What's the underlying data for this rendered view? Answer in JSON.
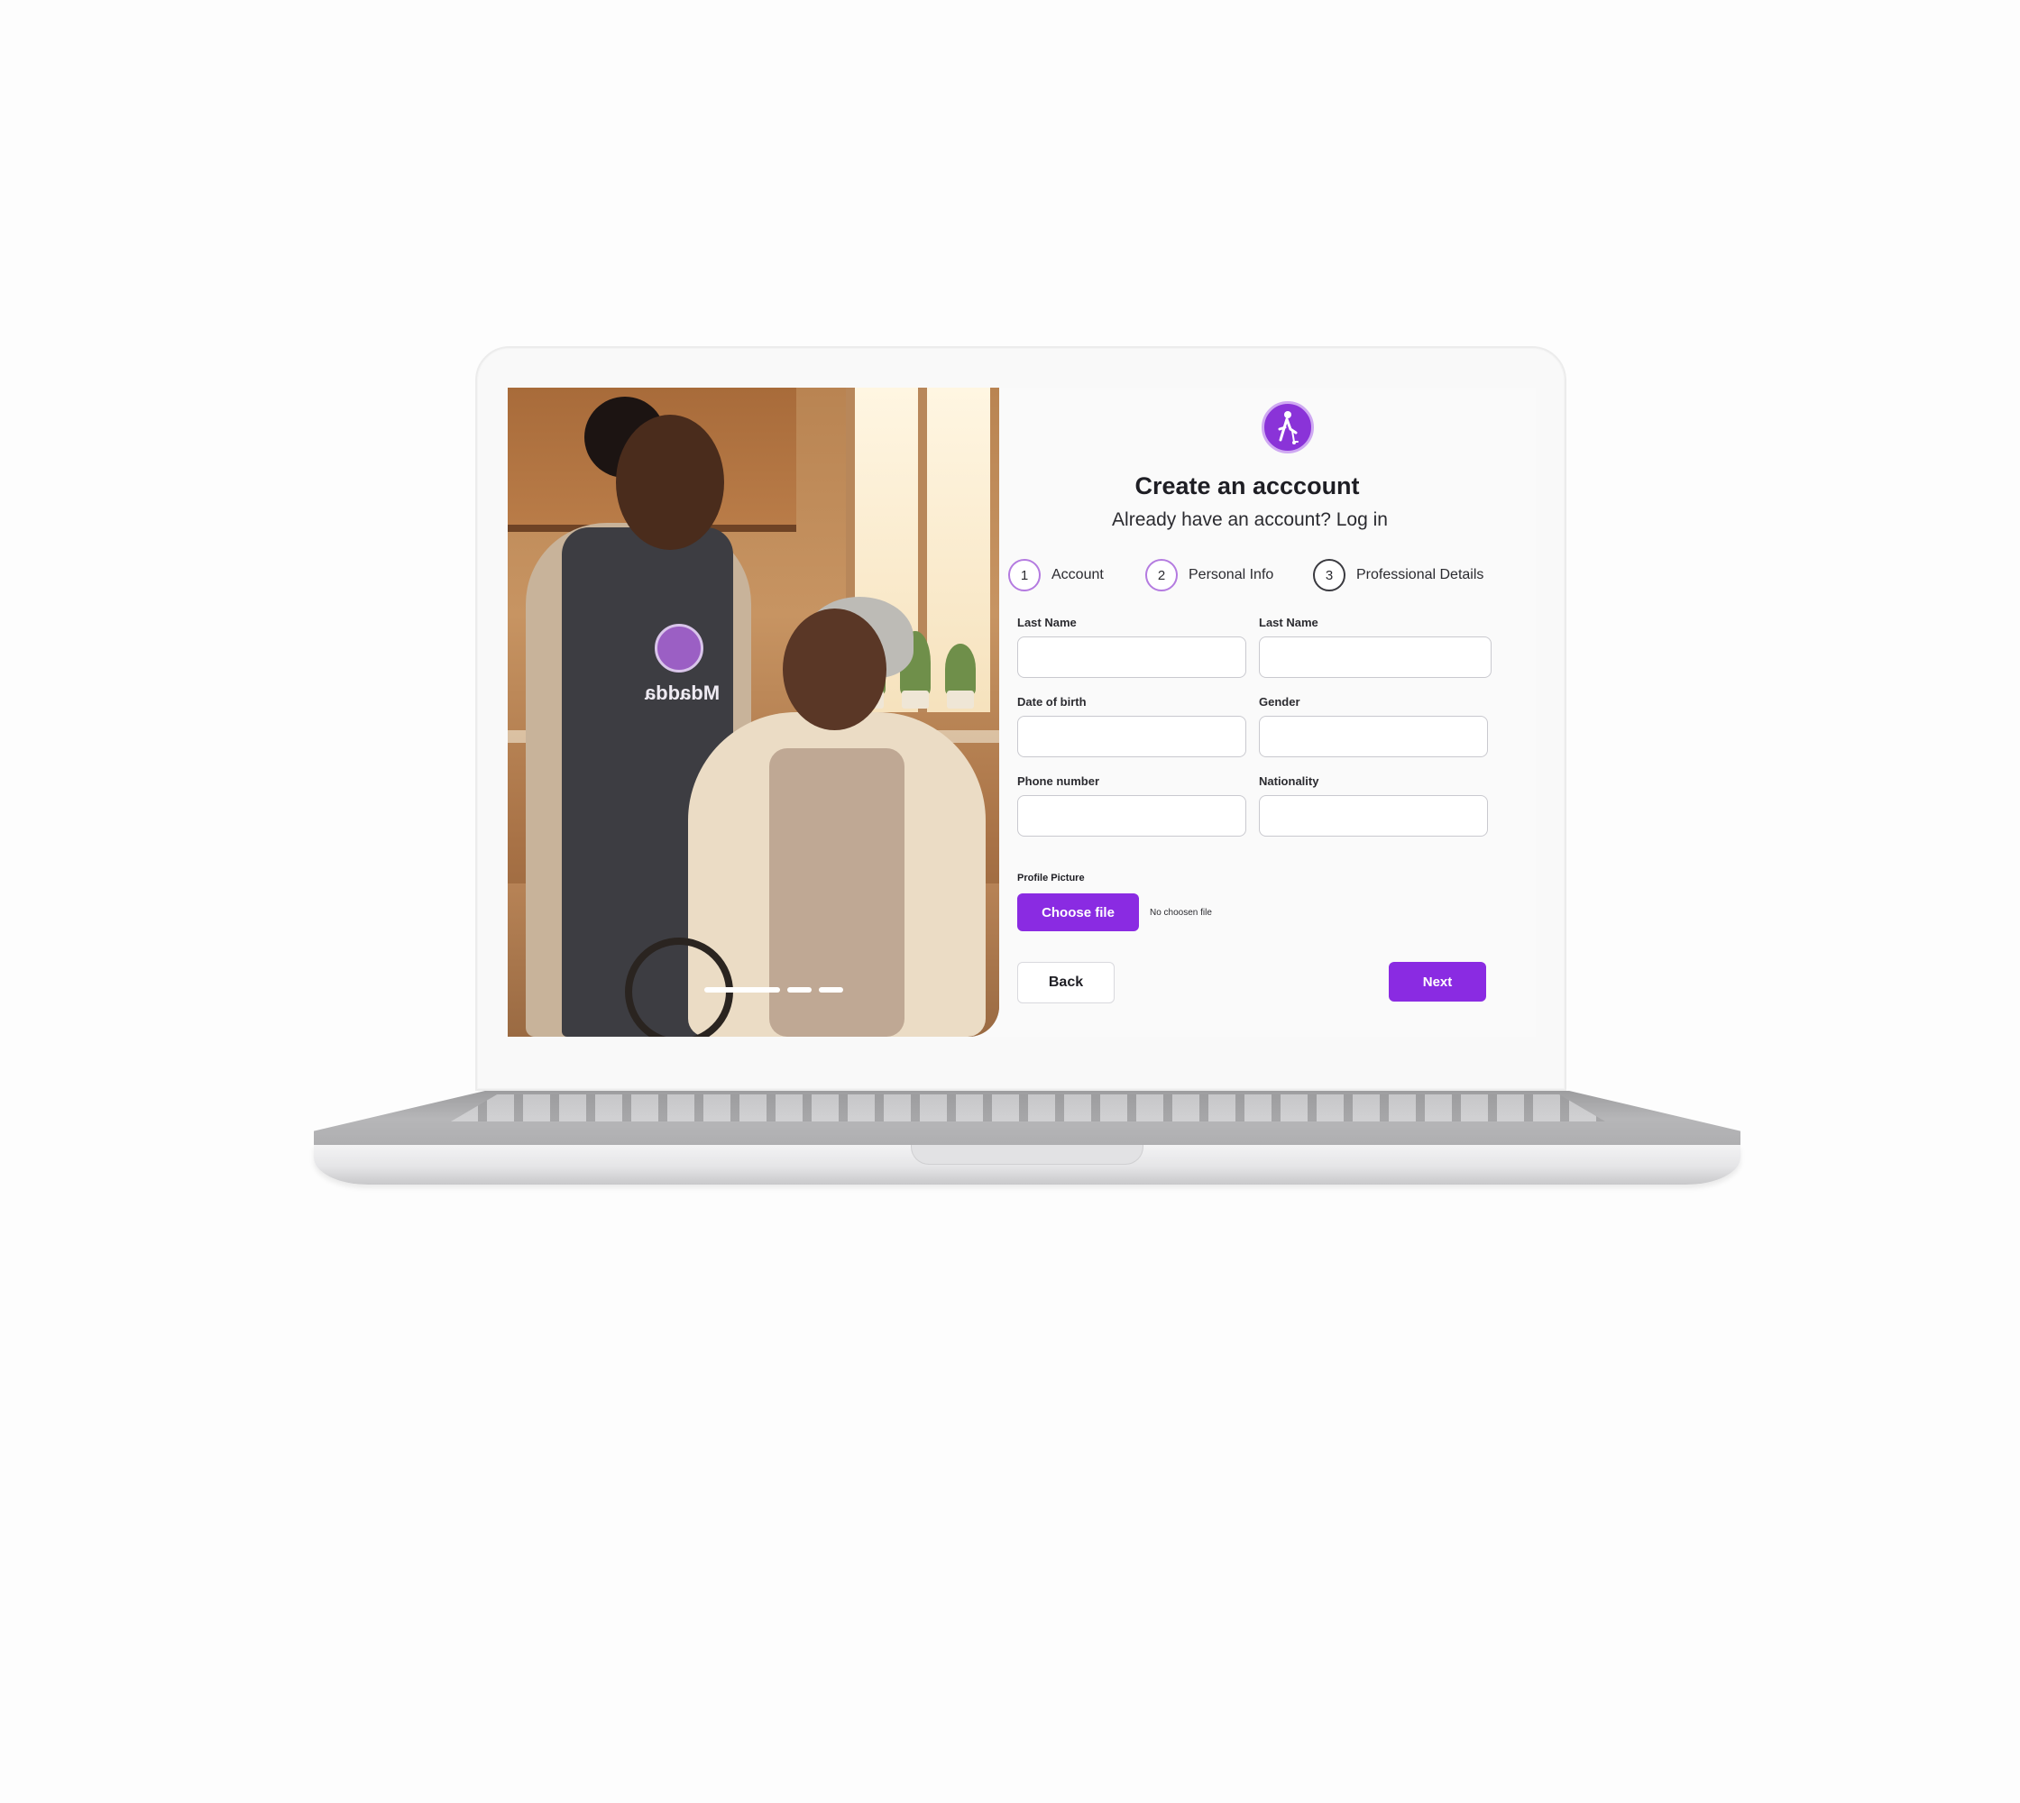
{
  "brand": {
    "logo_icon": "walker-person-icon",
    "accent_color": "#8a2be2",
    "apron_logo_text": "Mdadda"
  },
  "header": {
    "title": "Create an acccount",
    "subtitle": "Already have an account? Log in"
  },
  "steps": [
    {
      "number": "1",
      "label": "Account"
    },
    {
      "number": "2",
      "label": "Personal Info"
    },
    {
      "number": "3",
      "label": "Professional Details"
    }
  ],
  "fields": {
    "first_name": {
      "label": "Last Name",
      "value": ""
    },
    "last_name": {
      "label": "Last Name",
      "value": ""
    },
    "dob": {
      "label": "Date of birth",
      "value": ""
    },
    "gender": {
      "label": "Gender",
      "value": ""
    },
    "phone": {
      "label": "Phone number",
      "value": ""
    },
    "nationality": {
      "label": "Nationality",
      "value": ""
    }
  },
  "upload": {
    "label": "Profile Picture",
    "button_label": "Choose file",
    "status": "No choosen file"
  },
  "actions": {
    "back_label": "Back",
    "next_label": "Next"
  },
  "carousel": {
    "slides": 3,
    "active_index": 0
  }
}
